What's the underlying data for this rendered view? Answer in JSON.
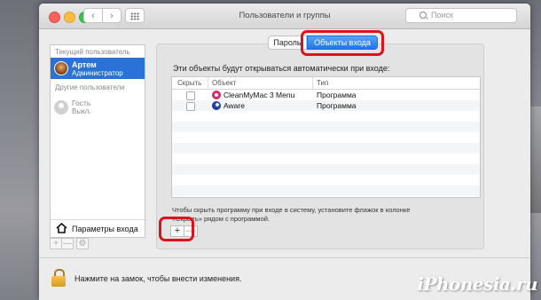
{
  "window": {
    "title": "Пользователи и группы"
  },
  "toolbar": {
    "search_placeholder": "Поиск",
    "back_icon": "chevron-left-icon",
    "forward_icon": "chevron-right-icon",
    "grid_icon": "show-all-grid-icon"
  },
  "sidebar": {
    "current_section": "Текущий пользователь",
    "current_user": {
      "name": "Артем",
      "role": "Администратор"
    },
    "other_section": "Другие пользователи",
    "other_users": [
      {
        "name": "Гость",
        "status": "Выкл."
      }
    ],
    "login_options": "Параметры входа",
    "buttons": [
      "+",
      "—",
      "⚙"
    ]
  },
  "tabs": [
    {
      "label": "Пароль",
      "active": false
    },
    {
      "label": "Объекты входа",
      "active": true
    }
  ],
  "main": {
    "intro": "Эти объекты будут открываться автоматически при входе:",
    "columns": [
      "Скрыть",
      "Объект",
      "Тип"
    ],
    "rows": [
      {
        "hide": false,
        "name": "CleanMyMac 3 Menu",
        "type": "Программа"
      },
      {
        "hide": false,
        "name": "Aware",
        "type": "Программа"
      }
    ],
    "hint": "Чтобы скрыть программу при входе в систему, установите флажок в колонке «Скрыть» рядом с программой.",
    "add_label": "+",
    "remove_label": "—"
  },
  "footer": {
    "lock_text": "Нажмите на замок, чтобы внести изменения."
  },
  "watermark": "iPhonesia.ru",
  "colors": {
    "selection": "#2a72d7",
    "highlight": "#e0111e",
    "tab_active": "#1d76e6"
  }
}
